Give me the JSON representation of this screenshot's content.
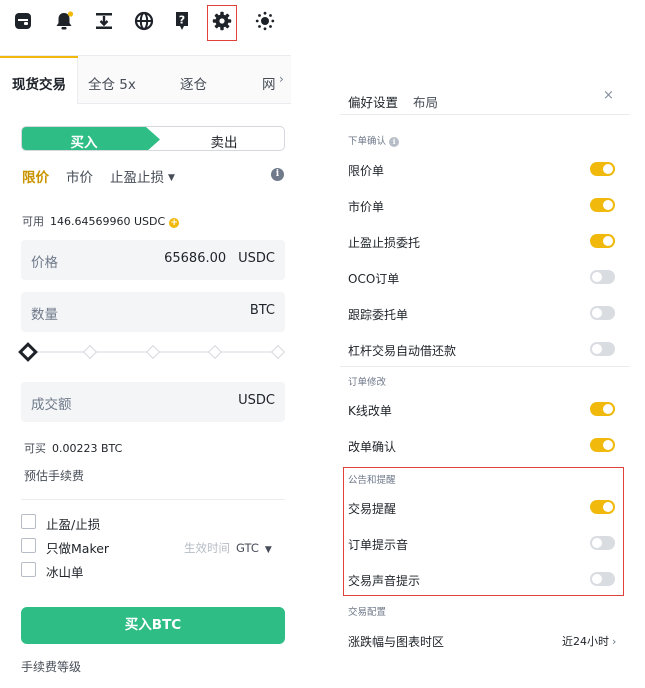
{
  "toolbar": {
    "icons": [
      "wallet-icon",
      "bell-icon",
      "download-icon",
      "globe-icon",
      "help-icon",
      "gear-icon",
      "theme-icon"
    ],
    "notification_dot_color": "#f0b90b",
    "highlight_color": "#e0413a"
  },
  "left": {
    "tabs": [
      "现货交易",
      "全仓 5x",
      "逐仓",
      "网"
    ],
    "tab_more": "›",
    "buy_label": "买入",
    "sell_label": "卖出",
    "order_types": [
      "限价",
      "市价",
      "止盈止损"
    ],
    "available_label": "可用",
    "available_value": "146.64569960 USDC",
    "price_label": "价格",
    "price_value": "65686.00",
    "price_unit": "USDC",
    "amount_label": "数量",
    "amount_unit": "BTC",
    "slider_percent": 0,
    "total_label": "成交额",
    "total_unit": "USDC",
    "max_buy_label": "可买",
    "max_buy_value": "0.00223 BTC",
    "est_fee_label": "预估手续费",
    "checkboxes": [
      {
        "label": "止盈/止损",
        "checked": false
      },
      {
        "label": "只做Maker",
        "checked": false
      },
      {
        "label": "冰山单",
        "checked": false
      }
    ],
    "tif_label": "生效时间",
    "tif_value": "GTC",
    "buy_button": "买入BTC",
    "fee_level": "手续费等级",
    "colors": {
      "buy": "#2ebd85",
      "accent": "#c99400"
    }
  },
  "right": {
    "tabs": [
      "偏好设置",
      "布局"
    ],
    "close": "×",
    "sections": [
      {
        "title": "下单确认",
        "items": [
          {
            "label": "限价单",
            "on": true
          },
          {
            "label": "市价单",
            "on": true
          },
          {
            "label": "止盈止损委托",
            "on": true
          },
          {
            "label": "OCO订单",
            "on": false
          },
          {
            "label": "跟踪委托单",
            "on": false
          },
          {
            "label": "杠杆交易自动借还款",
            "on": false
          }
        ]
      },
      {
        "title": "订单修改",
        "items": [
          {
            "label": "K线改单",
            "on": true
          },
          {
            "label": "改单确认",
            "on": true
          }
        ]
      },
      {
        "title": "公告和提醒",
        "items": [
          {
            "label": "交易提醒",
            "on": true
          },
          {
            "label": "订单提示音",
            "on": false
          },
          {
            "label": "交易声音提示",
            "on": false
          }
        ]
      },
      {
        "title": "交易配置",
        "items": [
          {
            "label": "涨跌幅与图表时区",
            "value": "近24小时"
          }
        ]
      }
    ],
    "colors": {
      "toggle_on": "#f0b90b",
      "toggle_off": "#d9dde2"
    }
  }
}
